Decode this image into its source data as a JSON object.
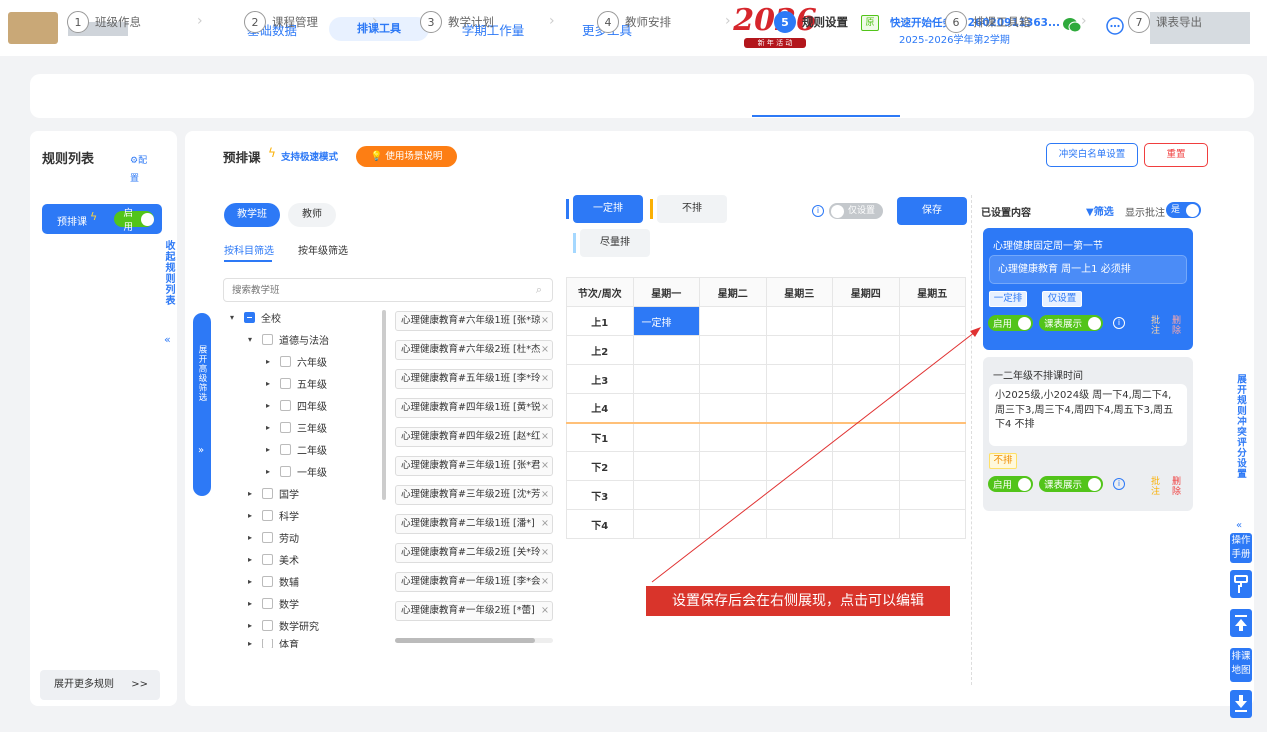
{
  "header": {
    "nav": [
      "基础数据",
      "排课工具",
      "学期工作量",
      "更多工具"
    ],
    "logo_year": "2026",
    "logo_sub": "新 年 活 动",
    "badge": "原",
    "task_title": "快速开始任务2026020911363...",
    "term": "2025-2026学年第2学期"
  },
  "steps": [
    {
      "num": "1",
      "label": "班级作息"
    },
    {
      "num": "2",
      "label": "课程管理"
    },
    {
      "num": "3",
      "label": "教学计划"
    },
    {
      "num": "4",
      "label": "教师安排"
    },
    {
      "num": "5",
      "label": "规则设置"
    },
    {
      "num": "6",
      "label": "排课工具箱"
    },
    {
      "num": "7",
      "label": "课表导出"
    }
  ],
  "left": {
    "title": "规则列表",
    "config": "配置",
    "rule_name": "预排课",
    "rule_toggle": "启用",
    "collapse": "收起规则列表",
    "more": "展开更多规则",
    "more_arrow": ">>"
  },
  "main": {
    "title": "预排课",
    "speed": "支持极速模式",
    "scene_btn": "使用场景说明",
    "whitelist_btn": "冲突白名单设置",
    "reset_btn": "重置",
    "tabs": [
      "教学班",
      "教师"
    ],
    "filters": [
      "按科目筛选",
      "按年级筛选"
    ],
    "search_placeholder": "搜索教学班",
    "adv_filter": "展开高级筛选",
    "adv_arrow": "»"
  },
  "tree": [
    {
      "label": "全校",
      "level": 0
    },
    {
      "label": "道德与法治",
      "level": 1
    },
    {
      "label": "六年级",
      "level": 2
    },
    {
      "label": "五年级",
      "level": 2
    },
    {
      "label": "四年级",
      "level": 2
    },
    {
      "label": "三年级",
      "level": 2
    },
    {
      "label": "二年级",
      "level": 2
    },
    {
      "label": "一年级",
      "level": 2
    },
    {
      "label": "国学",
      "level": 1
    },
    {
      "label": "科学",
      "level": 1
    },
    {
      "label": "劳动",
      "level": 1
    },
    {
      "label": "美术",
      "level": 1
    },
    {
      "label": "数辅",
      "level": 1
    },
    {
      "label": "数学",
      "level": 1
    },
    {
      "label": "数学研究",
      "level": 1
    },
    {
      "label": "体育",
      "level": 1
    }
  ],
  "classes": [
    "心理健康教育#六年级1班 [张*琼]",
    "心理健康教育#六年级2班 [杜*杰]",
    "心理健康教育#五年级1班 [李*玲]",
    "心理健康教育#四年级1班 [黄*锐]",
    "心理健康教育#四年级2班 [赵*红]",
    "心理健康教育#三年级1班 [张*君]",
    "心理健康教育#三年级2班 [沈*芳]",
    "心理健康教育#二年级1班 [潘*]",
    "心理健康教育#二年级2班 [关*玲]",
    "心理健康教育#一年级1班 [李*会]",
    "心理健康教育#一年级2班 [*蕾]"
  ],
  "modes": {
    "fixed": "一定排",
    "exclude": "不排",
    "prefer": "尽量排",
    "only_set": "仅设置",
    "save": "保存"
  },
  "table": {
    "header": [
      "节次/周次",
      "星期一",
      "星期二",
      "星期三",
      "星期四",
      "星期五"
    ],
    "rows": [
      "上1",
      "上2",
      "上3",
      "上4",
      "下1",
      "下2",
      "下3",
      "下4"
    ],
    "filled": "一定排"
  },
  "right": {
    "title": "已设置内容",
    "filter": "筛选",
    "show_note": "显示批注",
    "show_note_val": "是",
    "card1": {
      "title": "心理健康固定周一第一节",
      "desc": "心理健康教育 周一上1 必须排",
      "tag1": "一定排",
      "tag2": "仅设置",
      "enable": "启用",
      "display": "课表展示",
      "note": "批注",
      "del": "删除"
    },
    "card2": {
      "title": "一二年级不排课时间",
      "desc": "小2025级,小2024级 周一下4,周二下4,周三下3,周三下4,周四下4,周五下3,周五下4 不排",
      "tag": "不排",
      "enable": "启用",
      "display": "课表展示",
      "note": "批注",
      "del": "删除"
    }
  },
  "annotation": "设置保存后会在右侧展现，点击可以编辑",
  "sidebar": {
    "conflict": "展开规则冲突评分设置",
    "conflict_arrow": "«",
    "manual": "操作手册",
    "map": "排课地图"
  }
}
